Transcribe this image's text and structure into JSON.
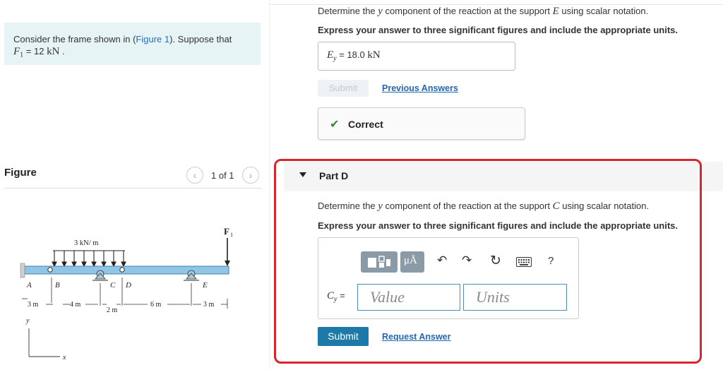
{
  "problem": {
    "text_before_link": "Consider the frame shown in (",
    "figure_link": "Figure 1",
    "text_after_link": "). Suppose that",
    "f1_symbol": "F",
    "f1_sub": "1",
    "f1_eq": " = 12 ",
    "f1_unit": "kN",
    "f1_period": " ."
  },
  "figure": {
    "label": "Figure",
    "page_count": "1 of 1",
    "prev_icon": "chevron-left-icon",
    "next_icon": "chevron-right-icon",
    "load_label": "3 kN/ m",
    "force_label_main": "F",
    "force_label_sub": "1",
    "point_labels": [
      "A",
      "B",
      "C",
      "D",
      "E"
    ],
    "dimensions": [
      "3 m",
      "4 m",
      "2 m",
      "6 m",
      "3 m"
    ],
    "axis_y": "y",
    "axis_x": "x"
  },
  "part_c": {
    "question_pre": "Determine the ",
    "question_var": "y",
    "question_mid": " component of the reaction at the support ",
    "question_support": "E",
    "question_post": " using scalar notation.",
    "instruction": "Express your answer to three significant figures and include the appropriate units.",
    "answer_label_main": "E",
    "answer_label_sub": "y",
    "answer_label_eq": " = ",
    "answer_value": "18.0 ",
    "answer_unit": "kN",
    "submit_label": "Submit",
    "previous_answers_label": "Previous Answers",
    "status_icon": "checkmark-icon",
    "status_text": "Correct",
    "status_color": "#2e8b2e"
  },
  "part_d": {
    "title": "Part D",
    "collapse_icon": "triangle-down-icon",
    "question_pre": "Determine the ",
    "question_var": "y",
    "question_mid": " component of the reaction at the support ",
    "question_support": "C",
    "question_post": " using scalar notation.",
    "instruction": "Express your answer to three significant figures and include the appropriate units.",
    "toolbar": {
      "template_icon": "template-icon",
      "units_icon": "units-mu-a-icon",
      "units_symbol": "μÅ",
      "undo_icon": "undo-icon",
      "redo_icon": "redo-icon",
      "reset_icon": "reset-icon",
      "keyboard_icon": "keyboard-icon",
      "help_label": "?"
    },
    "input_label_main": "C",
    "input_label_sub": "y",
    "input_label_eq": " =",
    "value_placeholder": "Value",
    "units_placeholder": "Units",
    "submit_label": "Submit",
    "request_answer_label": "Request Answer",
    "highlight_color": "#d9262c"
  }
}
